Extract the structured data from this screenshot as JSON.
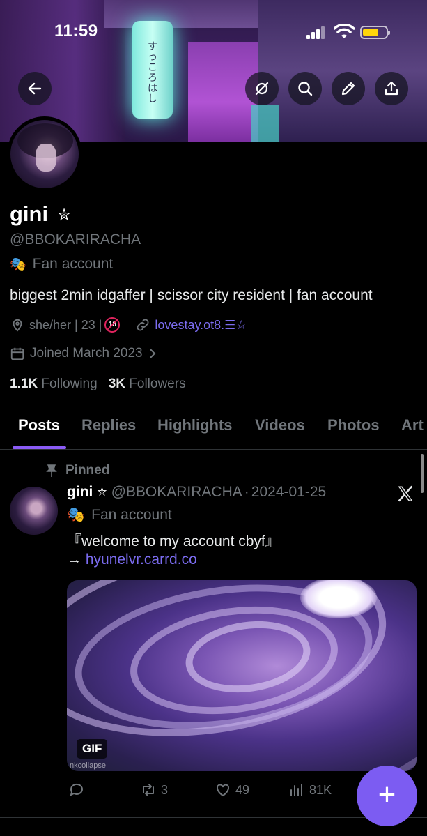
{
  "status_bar": {
    "time": "11:59"
  },
  "header": {
    "back_icon": "arrow-left-icon",
    "buttons": [
      "grok-icon",
      "search-icon",
      "edit-icon",
      "share-icon"
    ],
    "banner_text": "すっころはし"
  },
  "profile": {
    "name": "gini",
    "name_emoji": "✮",
    "handle": "@BBOKARIRACHA",
    "label_emoji": "🎭",
    "label": "Fan account",
    "bio": "biggest 2min idgaffer | scissor city resident | fan account",
    "location": "she/her | 23 |",
    "no18_text": "18",
    "website": "lovestay.ot8.☰☆",
    "joined": "Joined March 2023",
    "following_count": "1.1K",
    "following_label": "Following",
    "followers_count": "3K",
    "followers_label": "Followers"
  },
  "tabs": [
    {
      "label": "Posts",
      "active": true
    },
    {
      "label": "Replies"
    },
    {
      "label": "Highlights"
    },
    {
      "label": "Videos"
    },
    {
      "label": "Photos"
    },
    {
      "label": "Art"
    }
  ],
  "tweet": {
    "pinned_label": "Pinned",
    "name": "gini",
    "name_emoji": "✮",
    "handle": "@BBOKARIRACHA",
    "separator": "·",
    "date": "2024-01-25",
    "label_emoji": "🎭",
    "label": "Fan account",
    "text_line1": "『welcome to my account cbyf』",
    "arrow": "→",
    "link": "hyunelvr.carrd.co",
    "media_badge": "GIF",
    "media_watermark": "nkcollapse",
    "reply_count": "",
    "retweet_count": "3",
    "like_count": "49",
    "view_count": "81K"
  },
  "fab_label": "+",
  "colors": {
    "accent": "#7c5cf2",
    "link": "#7b6cf0",
    "muted": "#71767b"
  }
}
